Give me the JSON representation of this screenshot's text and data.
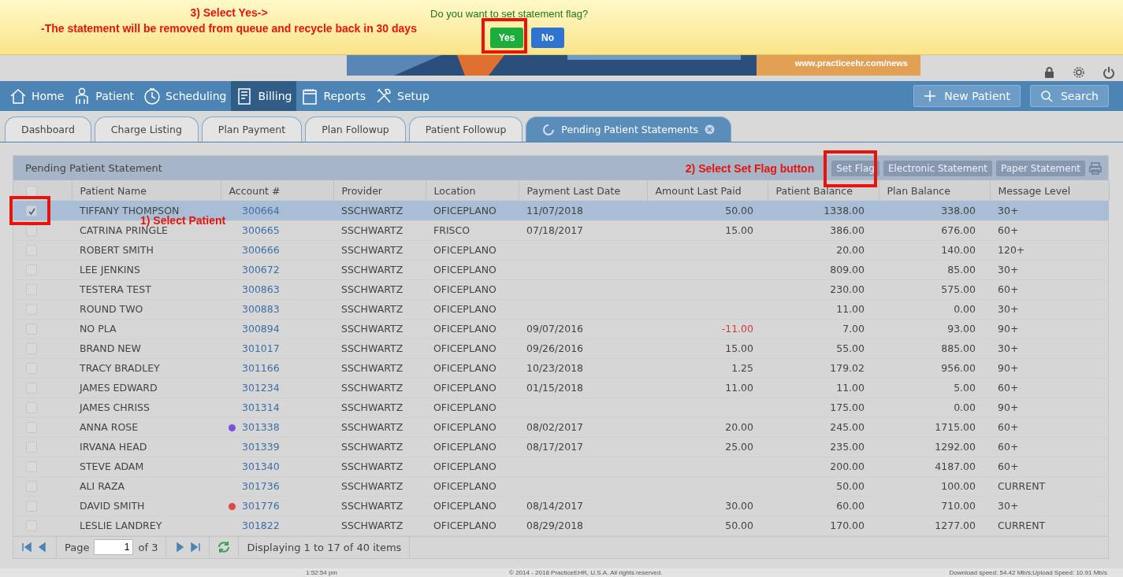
{
  "confirm_bar": {
    "question": "Do you want to set statement flag?",
    "buttons": [
      {
        "label": "Yes",
        "kind": "primary"
      },
      {
        "label": "No",
        "kind": "secondary"
      }
    ],
    "annotation_lines": [
      "3) Select Yes->",
      "-The statement will be removed from queue and recycle back in 30 days"
    ]
  },
  "banner": {
    "url": "www.practiceehr.com/news"
  },
  "nav": {
    "items": [
      {
        "label": "Home",
        "selected": false
      },
      {
        "label": "Patient",
        "selected": false
      },
      {
        "label": "Scheduling",
        "selected": false
      },
      {
        "label": "Billing",
        "selected": true
      },
      {
        "label": "Reports",
        "selected": false
      },
      {
        "label": "Setup",
        "selected": false
      }
    ],
    "actions": [
      "New Patient",
      "Search"
    ]
  },
  "tabs": [
    {
      "label": "Dashboard",
      "selected": false
    },
    {
      "label": "Charge Listing",
      "selected": false
    },
    {
      "label": "Plan Payment",
      "selected": false
    },
    {
      "label": "Plan Followup",
      "selected": false
    },
    {
      "label": "Patient Followup",
      "selected": false
    },
    {
      "label": "Pending Patient Statements",
      "selected": true
    }
  ],
  "panel": {
    "title": "Pending Patient Statement",
    "annotation": "2) Select Set Flag button",
    "buttons": [
      "Set Flag",
      "Electronic Statement",
      "Paper Statement"
    ]
  },
  "table": {
    "columns": [
      "Patient Name",
      "Account #",
      "Provider",
      "Location",
      "Payment Last Date",
      "Amount Last Paid",
      "Patient Balance",
      "Plan Balance",
      "Message Level"
    ],
    "annotation": "1) Select Patient",
    "select_all_checked": false,
    "rows": [
      {
        "checked": true,
        "selected": true,
        "name": "TIFFANY THOMPSON",
        "account": "300664",
        "provider": "SSCHWARTZ",
        "location": "OFICEPLANO",
        "last_date": "11/07/2018",
        "amount": "50.00",
        "amount_negative": false,
        "patient_balance": "1338.00",
        "plan_balance": "338.00",
        "level": "30+"
      },
      {
        "checked": false,
        "selected": false,
        "name": "CATRINA PRINGLE",
        "account": "300665",
        "provider": "SSCHWARTZ",
        "location": "FRISCO",
        "last_date": "07/18/2017",
        "amount": "15.00",
        "amount_negative": false,
        "patient_balance": "386.00",
        "plan_balance": "676.00",
        "level": "60+"
      },
      {
        "checked": false,
        "selected": false,
        "name": "ROBERT SMITH",
        "account": "300666",
        "provider": "SSCHWARTZ",
        "location": "OFICEPLANO",
        "patient_balance": "20.00",
        "plan_balance": "140.00",
        "level": "120+"
      },
      {
        "checked": false,
        "selected": false,
        "name": "LEE JENKINS",
        "account": "300672",
        "provider": "SSCHWARTZ",
        "location": "OFICEPLANO",
        "patient_balance": "809.00",
        "plan_balance": "85.00",
        "level": "30+"
      },
      {
        "checked": false,
        "selected": false,
        "name": "TESTERA TEST",
        "account": "300863",
        "provider": "SSCHWARTZ",
        "location": "OFICEPLANO",
        "patient_balance": "230.00",
        "plan_balance": "575.00",
        "level": "60+"
      },
      {
        "checked": false,
        "selected": false,
        "name": "ROUND TWO",
        "account": "300883",
        "provider": "SSCHWARTZ",
        "location": "OFICEPLANO",
        "patient_balance": "11.00",
        "plan_balance": "0.00",
        "level": "30+"
      },
      {
        "checked": false,
        "selected": false,
        "name": "NO PLA",
        "account": "300894",
        "provider": "SSCHWARTZ",
        "location": "OFICEPLANO",
        "last_date": "09/07/2016",
        "amount": "-11.00",
        "amount_negative": true,
        "patient_balance": "7.00",
        "plan_balance": "93.00",
        "level": "90+"
      },
      {
        "checked": false,
        "selected": false,
        "name": "BRAND NEW",
        "account": "301017",
        "provider": "SSCHWARTZ",
        "location": "OFICEPLANO",
        "last_date": "09/26/2016",
        "amount": "15.00",
        "amount_negative": false,
        "patient_balance": "55.00",
        "plan_balance": "885.00",
        "level": "30+"
      },
      {
        "checked": false,
        "selected": false,
        "name": "TRACY BRADLEY",
        "account": "301166",
        "provider": "SSCHWARTZ",
        "location": "OFICEPLANO",
        "last_date": "10/23/2018",
        "amount": "1.25",
        "amount_negative": false,
        "patient_balance": "179.02",
        "plan_balance": "956.00",
        "level": "90+"
      },
      {
        "checked": false,
        "selected": false,
        "name": "JAMES EDWARD",
        "account": "301234",
        "provider": "SSCHWARTZ",
        "location": "OFICEPLANO",
        "last_date": "01/15/2018",
        "amount": "11.00",
        "amount_negative": false,
        "patient_balance": "11.00",
        "plan_balance": "5.00",
        "level": "60+"
      },
      {
        "checked": false,
        "selected": false,
        "name": "JAMES CHRISS",
        "account": "301314",
        "provider": "SSCHWARTZ",
        "location": "OFICEPLANO",
        "patient_balance": "175.00",
        "plan_balance": "0.00",
        "level": "90+"
      },
      {
        "checked": false,
        "selected": false,
        "name": "ANNA ROSE",
        "color": "#7b4fe0",
        "account": "301338",
        "provider": "SSCHWARTZ",
        "location": "OFICEPLANO",
        "last_date": "08/02/2017",
        "amount": "20.00",
        "amount_negative": false,
        "patient_balance": "245.00",
        "plan_balance": "1715.00",
        "level": "60+"
      },
      {
        "checked": false,
        "selected": false,
        "name": "IRVANA HEAD",
        "account": "301339",
        "provider": "SSCHWARTZ",
        "location": "OFICEPLANO",
        "last_date": "08/17/2017",
        "amount": "25.00",
        "amount_negative": false,
        "patient_balance": "235.00",
        "plan_balance": "1292.00",
        "level": "60+"
      },
      {
        "checked": false,
        "selected": false,
        "name": "STEVE ADAM",
        "account": "301340",
        "provider": "SSCHWARTZ",
        "location": "OFICEPLANO",
        "patient_balance": "200.00",
        "plan_balance": "4187.00",
        "level": "60+"
      },
      {
        "checked": false,
        "selected": false,
        "name": "ALI RAZA",
        "account": "301736",
        "provider": "SSCHWARTZ",
        "location": "OFICEPLANO",
        "patient_balance": "50.00",
        "plan_balance": "100.00",
        "level": "CURRENT"
      },
      {
        "checked": false,
        "selected": false,
        "name": "DAVID SMITH",
        "color": "#e04848",
        "account": "301776",
        "provider": "SSCHWARTZ",
        "location": "OFICEPLANO",
        "last_date": "08/14/2017",
        "amount": "30.00",
        "amount_negative": false,
        "patient_balance": "60.00",
        "plan_balance": "710.00",
        "level": "30+"
      },
      {
        "checked": false,
        "selected": false,
        "name": "LESLIE LANDREY",
        "account": "301822",
        "provider": "SSCHWARTZ",
        "location": "OFICEPLANO",
        "last_date": "08/29/2018",
        "amount": "50.00",
        "amount_negative": false,
        "patient_balance": "170.00",
        "plan_balance": "1277.00",
        "level": "CURRENT"
      }
    ]
  },
  "pager": {
    "page_label": "Page",
    "page": "1",
    "of": "of 3",
    "summary": "Displaying 1 to 17 of 40 items"
  },
  "footer": {
    "time": "1:52:54 pm",
    "copyright": "© 2014 - 2018 PracticeEHR, U.S.A. All rights reserved.",
    "speed": "Download speed: 54.42 Mb/s;Upload Speed: 10.91 Mb/s"
  }
}
